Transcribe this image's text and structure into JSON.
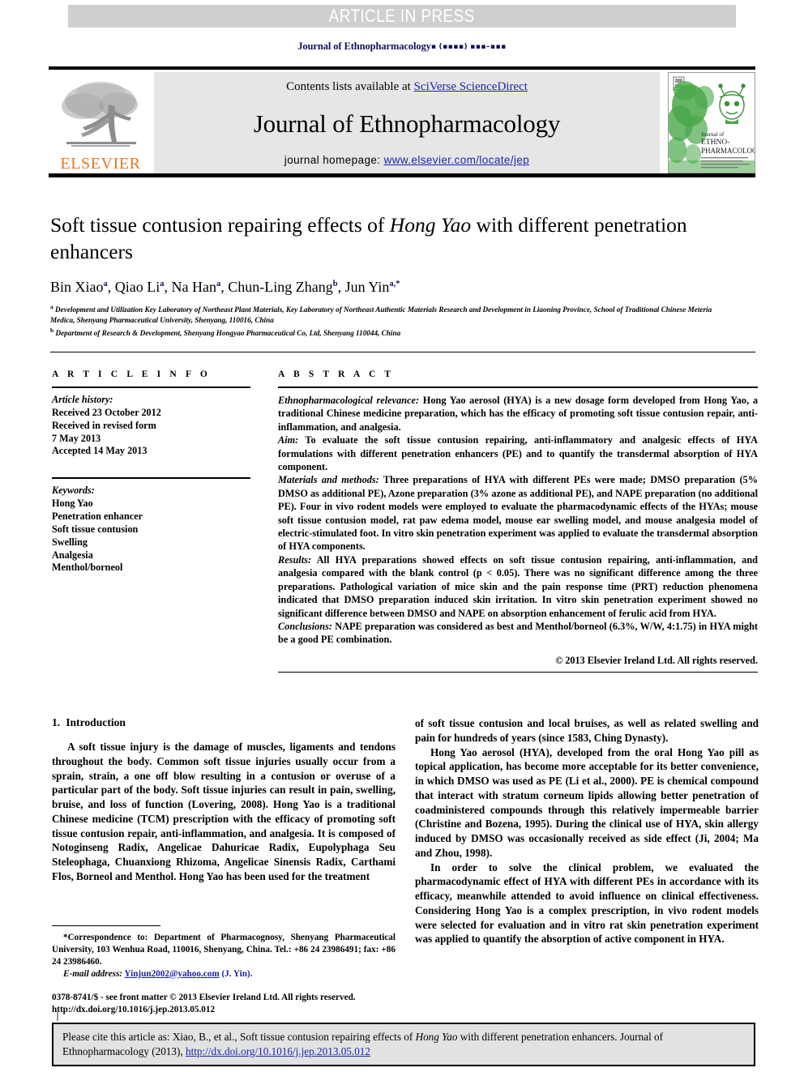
{
  "banner": {
    "text": "ARTICLE IN PRESS",
    "background": "#cfcfcf",
    "color": "#ffffff"
  },
  "running_head": {
    "journal": "Journal of Ethnopharmacology",
    "volume_placeholder": "▪",
    "year_placeholder": "(▪▪▪▪)",
    "pages_placeholder": "▪▪▪–▪▪▪",
    "color": "#12115c"
  },
  "masthead": {
    "publisher_logo_name": "elsevier-tree-logo",
    "publisher_wordmark": "ELSEVIER",
    "publisher_color": "#e87722",
    "contents_prefix": "Contents lists available at ",
    "contents_link": "SciVerse ScienceDirect",
    "journal_title": "Journal of Ethnopharmacology",
    "homepage_prefix": "journal homepage: ",
    "homepage_link": "www.elsevier.com/locate/jep",
    "link_color": "#1b24a8",
    "box_background": "#e6e6e6",
    "cover": {
      "name": "journal-cover-thumbnail",
      "line1": "Journal of",
      "line2": "ETHNO-",
      "line3": "PHARMACOLOGY",
      "color": "#4aa84a"
    }
  },
  "article": {
    "title_part1": "Soft tissue contusion repairing effects of ",
    "title_italic": "Hong Yao",
    "title_part2": " with different penetration enhancers",
    "authors": [
      {
        "name": "Bin Xiao",
        "sup": "a"
      },
      {
        "name": "Qiao Li",
        "sup": "a"
      },
      {
        "name": "Na Han",
        "sup": "a"
      },
      {
        "name": "Chun-Ling Zhang",
        "sup": "b"
      },
      {
        "name": "Jun Yin",
        "sup": "a,*"
      }
    ],
    "affiliations": [
      {
        "label": "a",
        "text": "Development and Utilization Key Laboratory of Northeast Plant Materials, Key Laboratory of Northeast Authentic Materials Research and Development in Liaoning Province, School of Traditional Chinese Meteria Medica, Shenyang Pharmaceutical University, Shenyang, 110016, China"
      },
      {
        "label": "b",
        "text": "Department of Research & Development, Shenyang Hongyao Pharmaceutical Co, Ltd, Shenyang 110044, China"
      }
    ]
  },
  "article_info": {
    "heading": "A R T I C L E  I N F O",
    "history_label": "Article history:",
    "history_lines": [
      "Received 23 October 2012",
      "Received in revised form",
      "7 May 2013",
      "Accepted 14 May 2013"
    ],
    "keywords_label": "Keywords:",
    "keywords": [
      "Hong Yao",
      "Penetration enhancer",
      "Soft tissue contusion",
      "Swelling",
      "Analgesia",
      "Menthol/borneol"
    ]
  },
  "abstract": {
    "heading": "A B S T R A C T",
    "sections": [
      {
        "label": "Ethnopharmacological relevance:",
        "text": " Hong Yao aerosol (HYA) is a new dosage form developed from Hong Yao, a traditional Chinese medicine preparation, which has the efficacy of promoting soft tissue contusion repair, anti-inflammation, and analgesia."
      },
      {
        "label": "Aim:",
        "text": " To evaluate the soft tissue contusion repairing, anti-inflammatory and analgesic effects of HYA formulations with different penetration enhancers (PE) and to quantify the transdermal absorption of HYA component."
      },
      {
        "label": "Materials and methods:",
        "text": " Three preparations of HYA with different PEs were made; DMSO preparation (5% DMSO as additional PE), Azone preparation (3% azone as additional PE), and NAPE preparation (no additional PE). Four in vivo rodent models were employed to evaluate the pharmacodynamic effects of the HYAs; mouse soft tissue contusion model, rat paw edema model, mouse ear swelling model, and mouse analgesia model of electric-stimulated foot. In vitro skin penetration experiment was applied to evaluate the transdermal absorption of HYA components."
      },
      {
        "label": "Results:",
        "text": " All HYA preparations showed effects on soft tissue contusion repairing, anti-inflammation, and analgesia compared with the blank control (p < 0.05). There was no significant difference among the three preparations. Pathological variation of mice skin and the pain response time (PRT) reduction phenomena indicated that DMSO preparation induced skin irritation. In vitro skin penetration experiment showed no significant difference between DMSO and NAPE on absorption enhancement of ferulic acid from HYA."
      },
      {
        "label": "Conclusions:",
        "text": " NAPE preparation was considered as best and Menthol/borneol (6.3%, W/W, 4:1.75) in HYA might be a good PE combination."
      }
    ],
    "copyright": "© 2013 Elsevier Ireland Ltd. All rights reserved."
  },
  "introduction": {
    "number": "1.",
    "heading": "Introduction",
    "left_paragraphs": [
      "A soft tissue injury is the damage of muscles, ligaments and tendons throughout the body. Common soft tissue injuries usually occur from a sprain, strain, a one off blow resulting in a contusion or overuse of a particular part of the body. Soft tissue injuries can result in pain, swelling, bruise, and loss of function (Lovering, 2008). Hong Yao is a traditional Chinese medicine (TCM) prescription with the efficacy of promoting soft tissue contusion repair, anti-inflammation, and analgesia. It is composed of Notoginseng Radix, Angelicae Dahuricae Radix, Eupolyphaga Seu Steleophaga, Chuanxiong Rhizoma, Angelicae Sinensis Radix, Carthami Flos, Borneol and Menthol. Hong Yao has been used for the treatment"
    ],
    "right_paragraphs": [
      "of soft tissue contusion and local bruises, as well as related swelling and pain for hundreds of years (since 1583, Ching Dynasty).",
      "Hong Yao aerosol (HYA), developed from the oral Hong Yao pill as topical application, has become more acceptable for its better convenience, in which DMSO was used as PE (Li et al., 2000). PE is chemical compound that interact with stratum corneum lipids allowing better penetration of coadministered compounds through this relatively impermeable barrier (Christine and Bozena, 1995). During the clinical use of HYA, skin allergy induced by DMSO was occasionally received as side effect (Ji, 2004; Ma and Zhou, 1998).",
      "In order to solve the clinical problem, we evaluated the pharmacodynamic effect of HYA with different PEs in accordance with its efficacy, meanwhile attended to avoid influence on clinical effectiveness. Considering Hong Yao is a complex prescription, in vivo rodent models were selected for evaluation and in vitro rat skin penetration experiment was applied to quantify the absorption of active component in HYA."
    ],
    "citation_color": "#12115c"
  },
  "footnotes": {
    "correspondence": "Correspondence to: Department of Pharmacognosy, Shenyang Pharmaceutical University, 103 Wenhua Road, 110016, Shenyang, China. Tel.: +86 24 23986491; fax: +86 24 23986460.",
    "email_label": "E-mail address:",
    "email": "Yinjun2002@yahoo.com",
    "email_author": "(J. Yin).",
    "imprint_line1": "0378-8741/$ - see front matter © 2013 Elsevier Ireland Ltd. All rights reserved.",
    "imprint_line2": "http://dx.doi.org/10.1016/j.jep.2013.05.012"
  },
  "cite_box": {
    "prefix": "Please cite this article as: Xiao, B., et al., Soft tissue contusion repairing effects of ",
    "italic": "Hong Yao",
    "middle": " with different penetration enhancers. Journal of Ethnopharmacology (2013), ",
    "link": "http://dx.doi.org/10.1016/j.jep.2013.05.012",
    "background": "#e2e2e2"
  }
}
